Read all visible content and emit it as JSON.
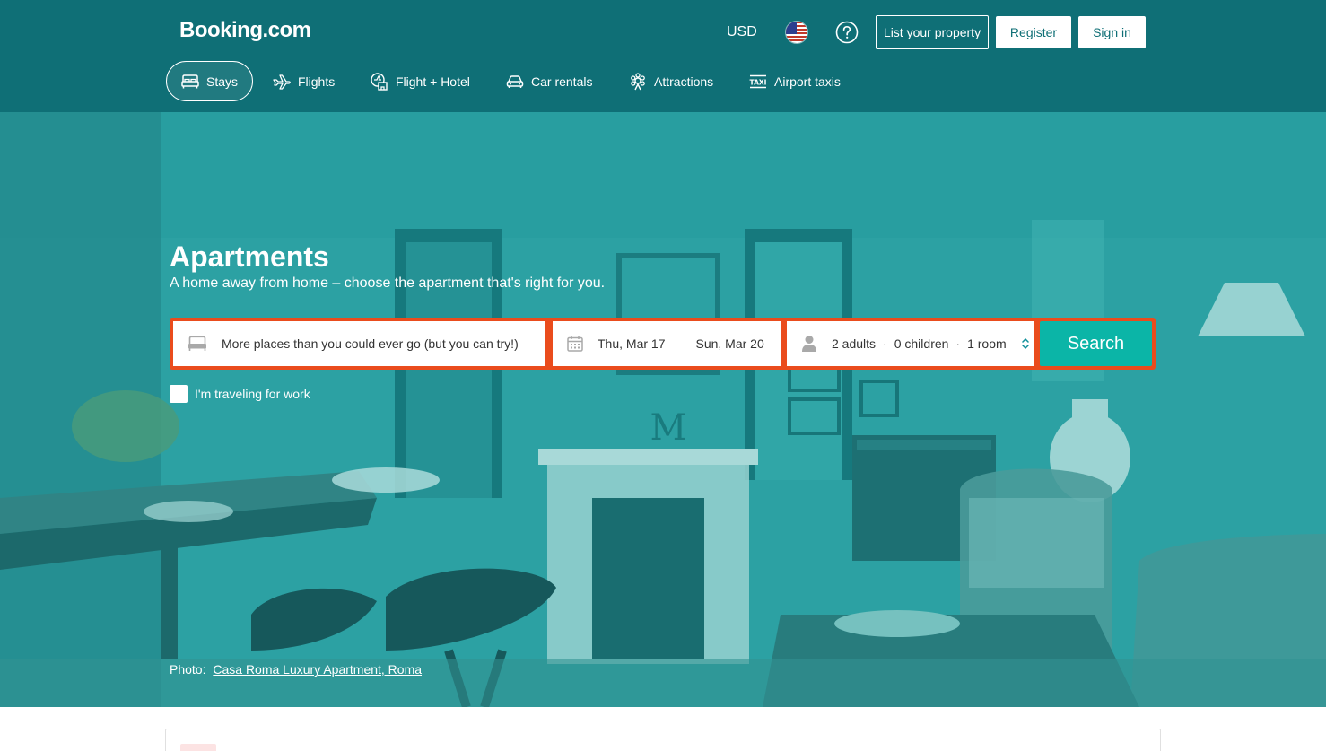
{
  "header": {
    "logo": "Booking.com",
    "currency": "USD",
    "list_property": "List your property",
    "register": "Register",
    "sign_in": "Sign in"
  },
  "nav": {
    "items": [
      {
        "label": "Stays",
        "icon": "bed-icon",
        "active": true
      },
      {
        "label": "Flights",
        "icon": "plane-icon"
      },
      {
        "label": "Flight + Hotel",
        "icon": "flight-hotel-icon"
      },
      {
        "label": "Car rentals",
        "icon": "car-icon"
      },
      {
        "label": "Attractions",
        "icon": "attractions-icon"
      },
      {
        "label": "Airport taxis",
        "icon": "taxi-icon"
      }
    ]
  },
  "hero": {
    "title": "Apartments",
    "subtitle": "A home away from home – choose the apartment that's right for you.",
    "destination_placeholder": "More places than you could ever go (but you can try!)",
    "check_in": "Thu, Mar 17",
    "check_out": "Sun, Mar 20",
    "date_separator": "—",
    "adults": "2 adults",
    "children": "0 children",
    "rooms": "1 room",
    "guest_separator": "·",
    "search": "Search",
    "work_travel": "I'm traveling for work",
    "photo_prefix": "Photo:",
    "photo_link": "Casa Roma Luxury Apartment, Roma"
  },
  "colors": {
    "header_bg": "#0f6f76",
    "hero_overlay": "#2c9698",
    "searchbar_border": "#ea4c1d",
    "search_button": "#0bb5a7"
  }
}
